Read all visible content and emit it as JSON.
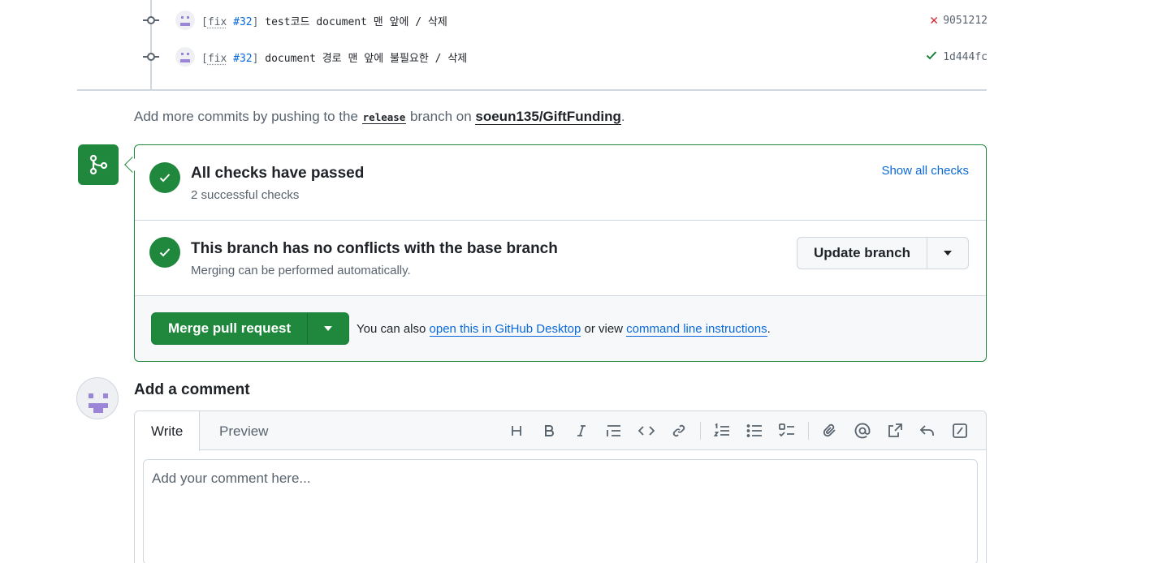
{
  "commits": [
    {
      "tag_open": "[",
      "tag_kw": "fix",
      "tag_num": "#32",
      "tag_close": "]",
      "message": "test코드 document 맨 앞에 / 삭제",
      "status": "failed",
      "status_icon": "x-icon",
      "sha": "9051212"
    },
    {
      "tag_open": "[",
      "tag_kw": "fix",
      "tag_num": "#32",
      "tag_close": "]",
      "message": "document 경로 맨 앞에 불필요한 / 삭제",
      "status": "success",
      "status_icon": "check-icon",
      "sha": "1d444fc"
    }
  ],
  "push_note": {
    "prefix": "Add more commits by pushing to the ",
    "branch": "release",
    "middle": " branch on ",
    "repo": "soeun135/GiftFunding",
    "suffix": "."
  },
  "checks": {
    "title": "All checks have passed",
    "subtitle": "2 successful checks",
    "show_all": "Show all checks"
  },
  "conflicts": {
    "title": "This branch has no conflicts with the base branch",
    "subtitle": "Merging can be performed automatically.",
    "update_button": "Update branch"
  },
  "merge": {
    "button": "Merge pull request",
    "alt_prefix": "You can also ",
    "alt_link1": "open this in GitHub Desktop",
    "alt_middle": " or view ",
    "alt_link2": "command line instructions",
    "alt_suffix": "."
  },
  "comment": {
    "title": "Add a comment",
    "tab_write": "Write",
    "tab_preview": "Preview",
    "placeholder": "Add your comment here..."
  },
  "colors": {
    "success": "#1f883d",
    "danger": "#d1242f",
    "link": "#0969da",
    "muted": "#59636e",
    "avatar_accent": "#9b85d6"
  },
  "toolbar_icons": [
    "heading-icon",
    "bold-icon",
    "italic-icon",
    "quote-icon",
    "code-icon",
    "link-icon",
    "ordered-list-icon",
    "unordered-list-icon",
    "task-list-icon",
    "attach-icon",
    "mention-icon",
    "cross-reference-icon",
    "reply-icon",
    "slash-command-icon"
  ]
}
